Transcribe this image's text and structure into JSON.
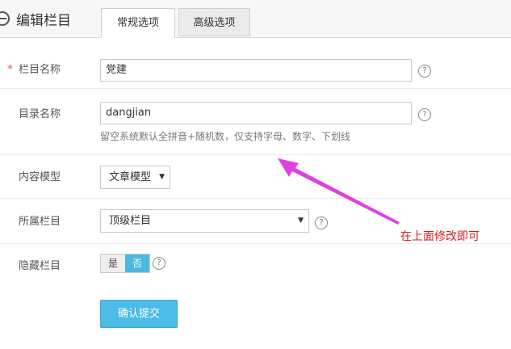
{
  "header": {
    "title": "编辑栏目",
    "tabs": [
      "常规选项",
      "高级选项"
    ]
  },
  "form": {
    "name": {
      "label": "栏目名称",
      "required_mark": "*",
      "value": "党建",
      "help": "?"
    },
    "dir": {
      "label": "目录名称",
      "value": "dangjian",
      "hint": "留空系统默认全拼音+随机数，仅支持字母、数字、下划线",
      "help": "?"
    },
    "model": {
      "label": "内容模型",
      "value": "文章模型"
    },
    "parent": {
      "label": "所属栏目",
      "value": "顶级栏目",
      "help": "?"
    },
    "hidden": {
      "label": "隐藏栏目",
      "options": [
        "是",
        "否"
      ],
      "selected": "否",
      "help": "?"
    },
    "submit": "确认提交"
  },
  "annotation": {
    "text": "在上面修改即可",
    "color": "#d02020",
    "arrow_color": "#e040e0"
  },
  "colors": {
    "accent": "#4cbce6",
    "required": "#e55555"
  }
}
